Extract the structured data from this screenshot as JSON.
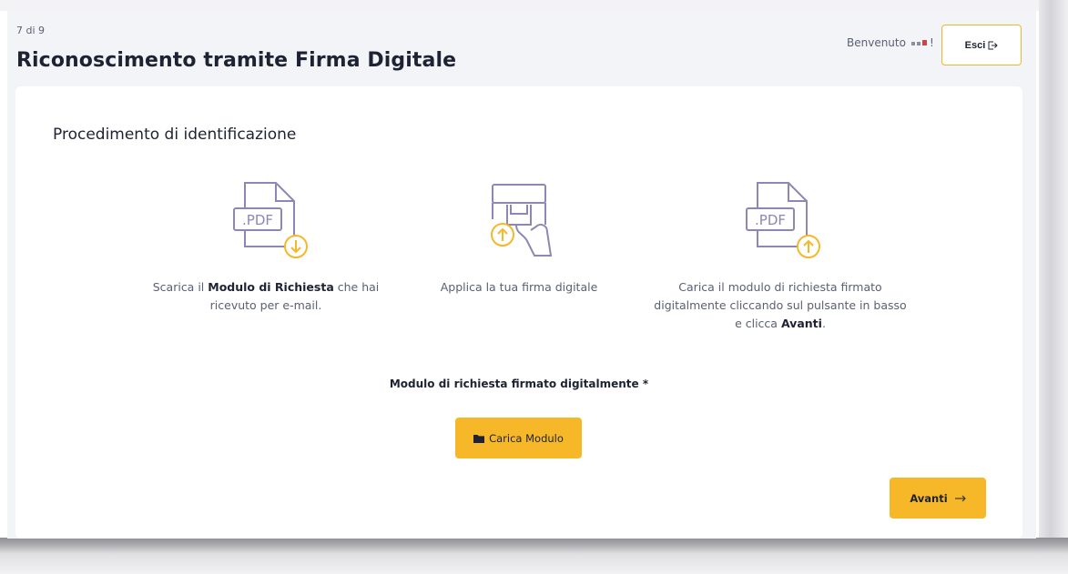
{
  "header": {
    "step_indicator": "7 di 9",
    "title": "Riconoscimento tramite Firma Digitale",
    "welcome": "Benvenuto",
    "welcome_suffix": "!",
    "logout_label": "Esci",
    "logout_icon": "logout-icon"
  },
  "main": {
    "section_title": "Procedimento di identificazione",
    "steps": [
      {
        "icon": "pdf-download-icon",
        "text_before": "Scarica il ",
        "text_bold": "Modulo di Richiesta",
        "text_after": " che hai ricevuto per e-mail.",
        "icon_label": ".PDF"
      },
      {
        "icon": "digital-signature-icon",
        "text": "Applica la tua firma digitale"
      },
      {
        "icon": "pdf-upload-icon",
        "text_before": "Carica il modulo di richiesta firmato digitalmente cliccando sul pulsante in basso e clicca ",
        "text_bold": "Avanti",
        "text_after": ".",
        "icon_label": ".PDF"
      }
    ],
    "upload": {
      "label": "Modulo di richiesta firmato digitalmente *",
      "button_label": "Carica Modulo",
      "button_icon": "folder-icon"
    },
    "next_button": {
      "label": "Avanti",
      "icon": "arrow-right-icon"
    }
  },
  "colors": {
    "accent": "#f6b728",
    "icon_stroke": "#8c87b3",
    "text_primary": "#1e2333",
    "text_secondary": "#5b6072",
    "background": "#f2f4f8"
  }
}
